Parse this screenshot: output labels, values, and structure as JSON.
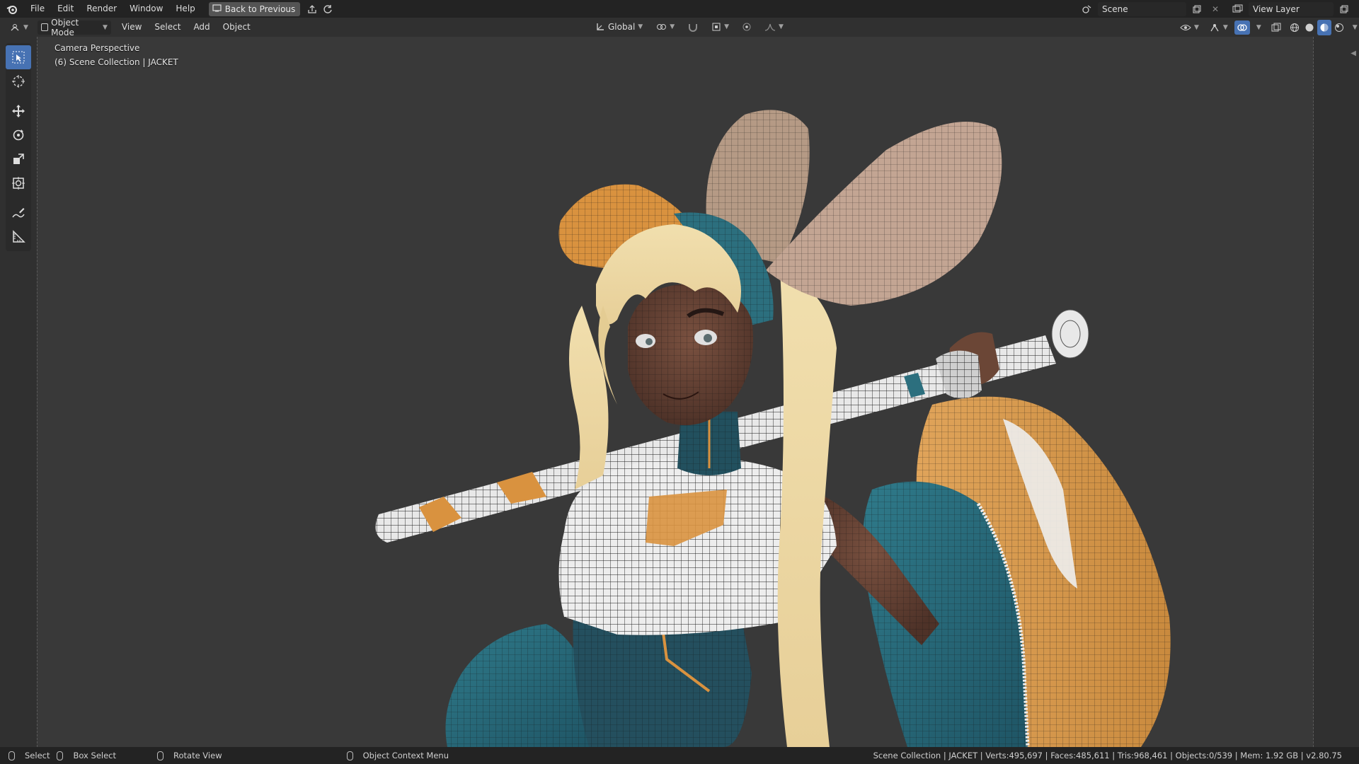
{
  "topbar": {
    "menu": [
      "File",
      "Edit",
      "Render",
      "Window",
      "Help"
    ],
    "back_button": "Back to Previous",
    "scene_name": "Scene",
    "view_layer_name": "View Layer"
  },
  "header": {
    "mode": "Object Mode",
    "menus": [
      "View",
      "Select",
      "Add",
      "Object"
    ],
    "transform_orientation": "Global"
  },
  "viewport": {
    "view_name": "Camera Perspective",
    "collection_info": "(6) Scene Collection | JACKET"
  },
  "toolbar": {
    "tools": [
      "select-box-icon",
      "cursor-icon",
      "move-icon",
      "rotate-icon",
      "scale-icon",
      "transform-icon",
      "annotate-icon",
      "measure-icon"
    ]
  },
  "statusbar": {
    "select": "Select",
    "box_select": "Box Select",
    "rotate_view": "Rotate View",
    "context_menu": "Object Context Menu",
    "stats": "Scene Collection | JACKET | Verts:495,697 | Faces:485,611 | Tris:968,461 | Objects:0/539 | Mem: 1.92 GB | v2.80.75"
  },
  "colors": {
    "accent": "#4772b3",
    "viewport_bg": "#393939",
    "jersey_teal": "#2c6f7e",
    "jersey_orange": "#d89a48"
  }
}
